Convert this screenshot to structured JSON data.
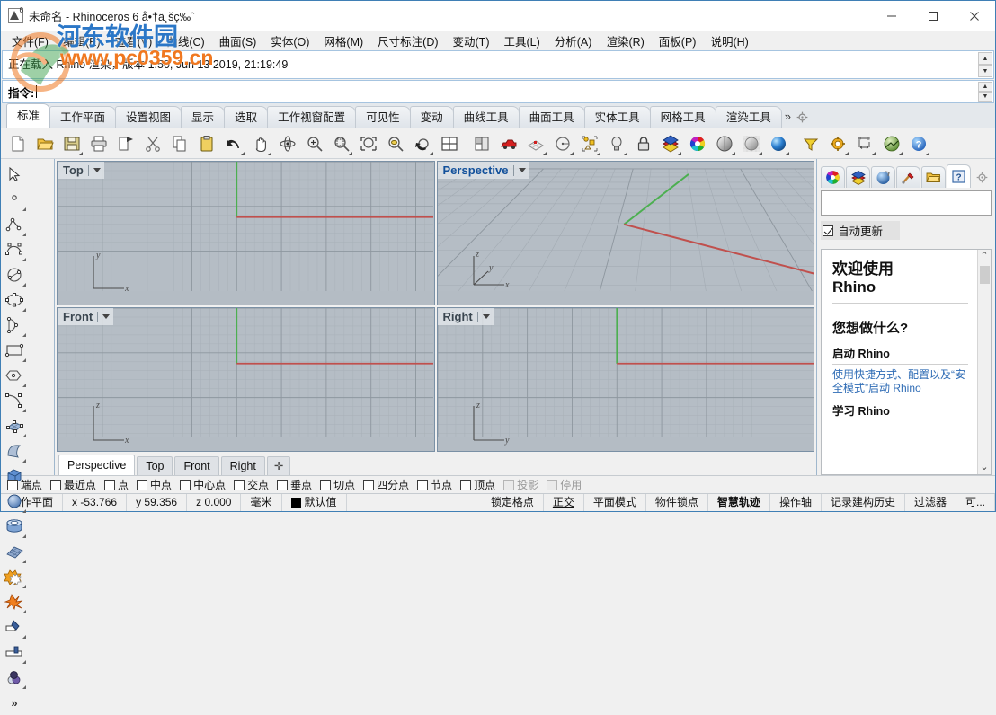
{
  "window": {
    "title": "未命名 - Rhinoceros 6 å•†ä¸šç‰ˆ",
    "minimize": "—",
    "maximize": "□",
    "close": "✕"
  },
  "menubar": {
    "items": [
      {
        "label": "文件(F)"
      },
      {
        "label": "编辑(E)"
      },
      {
        "label": "查看(V)"
      },
      {
        "label": "曲线(C)"
      },
      {
        "label": "曲面(S)"
      },
      {
        "label": "实体(O)"
      },
      {
        "label": "网格(M)"
      },
      {
        "label": "尺寸标注(D)"
      },
      {
        "label": "变动(T)"
      },
      {
        "label": "工具(L)"
      },
      {
        "label": "分析(A)"
      },
      {
        "label": "渲染(R)"
      },
      {
        "label": "面板(P)"
      },
      {
        "label": "说明(H)"
      }
    ]
  },
  "command": {
    "history": "正在载入 Rhino 渲染，版本 1.50, Jun 13 2019, 21:19:49",
    "prompt_label": "指令:",
    "prompt_value": "",
    "scroll_up": "▲",
    "scroll_down": "▼"
  },
  "ribbon": {
    "tabs": [
      {
        "label": "标准",
        "active": true
      },
      {
        "label": "工作平面",
        "active": false
      },
      {
        "label": "设置视图",
        "active": false
      },
      {
        "label": "显示",
        "active": false
      },
      {
        "label": "选取",
        "active": false
      },
      {
        "label": "工作视窗配置",
        "active": false
      },
      {
        "label": "可见性",
        "active": false
      },
      {
        "label": "变动",
        "active": false
      },
      {
        "label": "曲线工具",
        "active": false
      },
      {
        "label": "曲面工具",
        "active": false
      },
      {
        "label": "实体工具",
        "active": false
      },
      {
        "label": "网格工具",
        "active": false
      },
      {
        "label": "渲染工具",
        "active": false
      }
    ],
    "overflow": "»"
  },
  "toolbar": {
    "icons": [
      "new-file-icon",
      "open-folder-icon",
      "save-icon",
      "print-icon",
      "copy-to-clipboard-icon",
      "cut-icon",
      "copy-icon",
      "paste-icon",
      "undo-icon",
      "pan-icon",
      "rotate-view-icon",
      "zoom-in-icon",
      "zoom-window-icon",
      "zoom-extents-icon",
      "zoom-selected-icon",
      "zoom-previous-icon",
      "four-view-icon",
      "split-viewport-icon",
      "car-render-icon",
      "grid-snap-icon",
      "circle-tool-icon",
      "point-objects-icon",
      "light-bulb-icon",
      "lock-icon",
      "layer-icon",
      "color-wheel-icon",
      "shaded-view-icon",
      "ghosted-view-icon",
      "rendered-view-icon",
      "select-filter-icon",
      "options-gear-icon",
      "dimension-icon",
      "analysis-globe-icon",
      "help-icon"
    ]
  },
  "sidebar": {
    "icons": [
      "select-arrow-icon",
      "point-icon",
      "polyline-icon",
      "curve-interpolate-icon",
      "circle-icon",
      "ellipse-icon",
      "arc-icon",
      "rectangle-icon",
      "polygon-icon",
      "free-form-curve-icon",
      "surface-from-points-icon",
      "extrude-surface-icon",
      "box-icon",
      "sphere-icon",
      "cylinder-icon",
      "mesh-plane-icon",
      "boolean-union-icon",
      "explode-icon",
      "trim-icon",
      "split-icon",
      "render-material-icon",
      "more-tools-icon"
    ],
    "more_label": "»"
  },
  "viewports": [
    {
      "name": "Top",
      "active": false,
      "axes": [
        "y",
        "x"
      ],
      "type": "ortho-top"
    },
    {
      "name": "Perspective",
      "active": true,
      "axes": [
        "z",
        "y",
        "x"
      ],
      "type": "perspective"
    },
    {
      "name": "Front",
      "active": false,
      "axes": [
        "z",
        "x"
      ],
      "type": "ortho-front"
    },
    {
      "name": "Right",
      "active": false,
      "axes": [
        "z",
        "y"
      ],
      "type": "ortho-right"
    }
  ],
  "viewport_tabs": {
    "items": [
      {
        "label": "Perspective",
        "active": true
      },
      {
        "label": "Top",
        "active": false
      },
      {
        "label": "Front",
        "active": false
      },
      {
        "label": "Right",
        "active": false
      }
    ],
    "add_label": "✛"
  },
  "right_panel": {
    "tabs": [
      {
        "icon": "color-wheel-icon",
        "active": false
      },
      {
        "icon": "layers-icon",
        "active": false
      },
      {
        "icon": "material-sphere-icon",
        "active": false
      },
      {
        "icon": "paintbrush-icon",
        "active": false
      },
      {
        "icon": "folder-icon",
        "active": false
      },
      {
        "icon": "help-panel-icon",
        "active": true
      }
    ],
    "gear": "gear-icon",
    "search_value": "",
    "auto_update_label": "自动更新",
    "auto_update_checked": true,
    "help": {
      "heading1": "欢迎使用",
      "heading1b": "Rhino",
      "heading2": "您想做什么?",
      "section1": "启动 Rhino",
      "link1": "使用快捷方式、配置以及“安全模式”启动 Rhino",
      "section2": "学习 Rhino",
      "scroll_up": "⌃",
      "scroll_down": "⌄"
    }
  },
  "osnap": {
    "items": [
      {
        "label": "端点",
        "checked": false,
        "disabled": false
      },
      {
        "label": "最近点",
        "checked": false,
        "disabled": false
      },
      {
        "label": "点",
        "checked": false,
        "disabled": false
      },
      {
        "label": "中点",
        "checked": false,
        "disabled": false
      },
      {
        "label": "中心点",
        "checked": false,
        "disabled": false
      },
      {
        "label": "交点",
        "checked": false,
        "disabled": false
      },
      {
        "label": "垂点",
        "checked": false,
        "disabled": false
      },
      {
        "label": "切点",
        "checked": false,
        "disabled": false
      },
      {
        "label": "四分点",
        "checked": false,
        "disabled": false
      },
      {
        "label": "节点",
        "checked": false,
        "disabled": false
      },
      {
        "label": "顶点",
        "checked": false,
        "disabled": false
      },
      {
        "label": "投影",
        "checked": false,
        "disabled": true
      },
      {
        "label": "停用",
        "checked": false,
        "disabled": true
      }
    ]
  },
  "statusbar": {
    "cplane": "工作平面",
    "x": "x -53.766",
    "y": "y 59.356",
    "z": "z 0.000",
    "units": "毫米",
    "layer": "默认值",
    "layer_color": "#000000",
    "toggles": [
      {
        "label": "锁定格点",
        "style": "normal"
      },
      {
        "label": "正交",
        "style": "underline"
      },
      {
        "label": "平面模式",
        "style": "normal"
      },
      {
        "label": "物件锁点",
        "style": "normal"
      },
      {
        "label": "智慧轨迹",
        "style": "bold"
      },
      {
        "label": "操作轴",
        "style": "normal"
      },
      {
        "label": "记录建构历史",
        "style": "normal"
      },
      {
        "label": "过滤器",
        "style": "normal"
      },
      {
        "label": "可...",
        "style": "normal"
      }
    ]
  },
  "watermark": {
    "site": "www.pc0359.cn",
    "brand": "河东软件园"
  }
}
